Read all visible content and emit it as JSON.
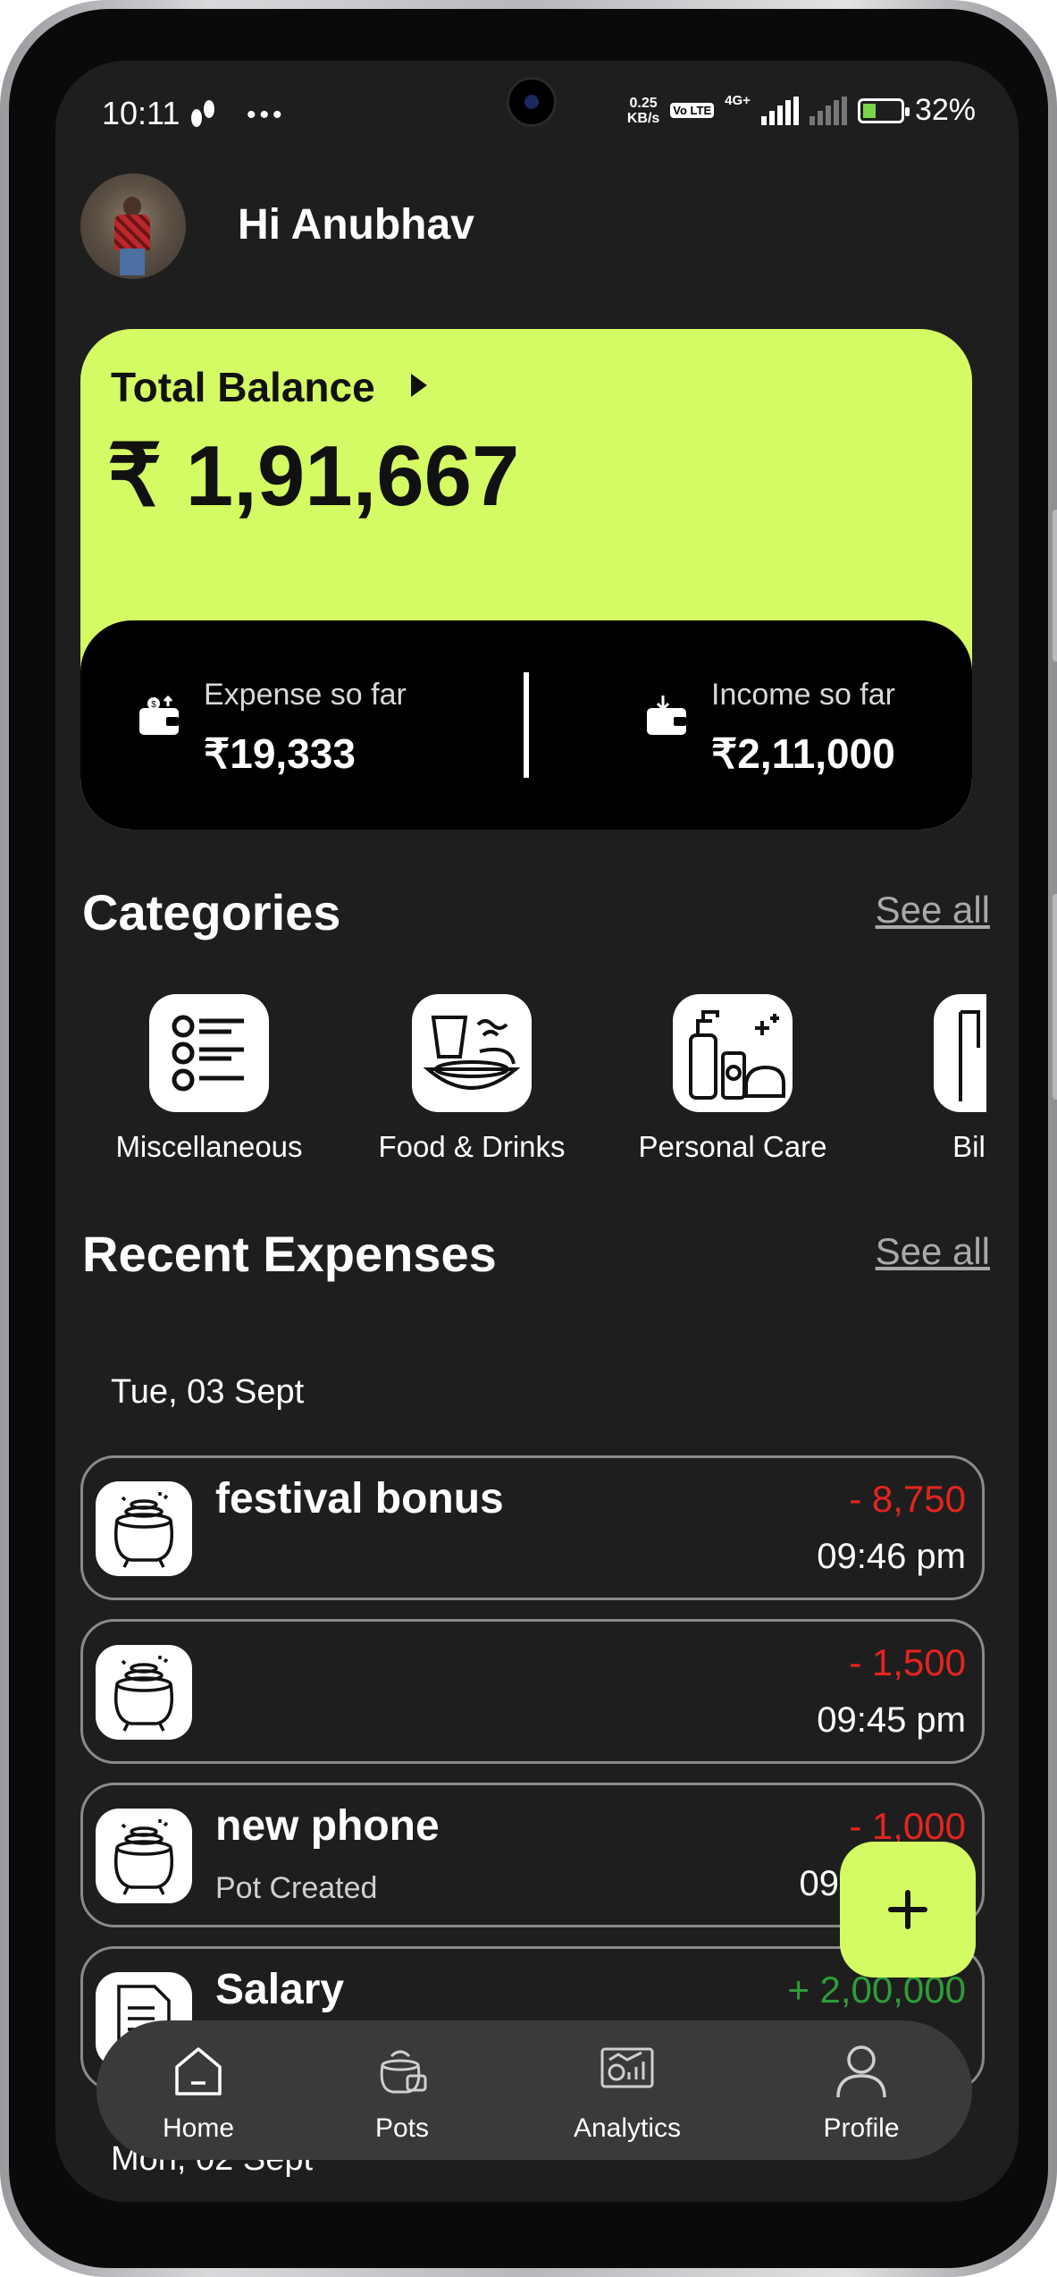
{
  "status_bar": {
    "time": "10:11",
    "network_speed": "0.25",
    "network_unit": "KB/s",
    "volte": "Vo LTE",
    "network_type": "4G+",
    "battery": "32%"
  },
  "header": {
    "greeting": "Hi Anubhav"
  },
  "balance": {
    "label": "Total Balance",
    "amount": "₹ 1,91,667",
    "expense_label": "Expense so far",
    "expense_value": "₹19,333",
    "income_label": "Income so far",
    "income_value": "₹2,11,000"
  },
  "categories": {
    "title": "Categories",
    "see_all": "See all",
    "items": [
      {
        "label": "Miscellaneous",
        "icon": "list-icon"
      },
      {
        "label": "Food & Drinks",
        "icon": "food-icon"
      },
      {
        "label": "Personal Care",
        "icon": "personal-care-icon"
      },
      {
        "label": "Bills &",
        "icon": "bills-icon"
      }
    ]
  },
  "recent": {
    "title": "Recent Expenses",
    "see_all": "See all",
    "date1": "Tue, 03 Sept",
    "rows": [
      {
        "title": "festival bonus",
        "subtitle": "",
        "amount": "- 8,750",
        "time": "09:46 pm",
        "icon": "pot-icon",
        "type": "negative"
      },
      {
        "title": "",
        "subtitle": "",
        "amount": "- 1,500",
        "time": "09:45 pm",
        "icon": "pot-icon",
        "type": "negative"
      },
      {
        "title": "new phone",
        "subtitle": "Pot Created",
        "amount": "- 1,000",
        "time": "09",
        "icon": "pot-icon",
        "type": "negative"
      },
      {
        "title": "Salary",
        "subtitle": "",
        "amount": "+ 2,00,000",
        "time": "",
        "icon": "salary-doc-icon",
        "type": "positive"
      }
    ],
    "date2": "Mon, 02 Sept"
  },
  "fab": {
    "symbol": "+"
  },
  "nav": {
    "items": [
      {
        "label": "Home",
        "icon": "home-icon"
      },
      {
        "label": "Pots",
        "icon": "pots-icon"
      },
      {
        "label": "Analytics",
        "icon": "analytics-icon"
      },
      {
        "label": "Profile",
        "icon": "profile-icon"
      }
    ]
  },
  "colors": {
    "accent": "#d4fb63",
    "background": "#1e1e1e",
    "negative": "#e5241f",
    "positive": "#2e9c3a"
  }
}
